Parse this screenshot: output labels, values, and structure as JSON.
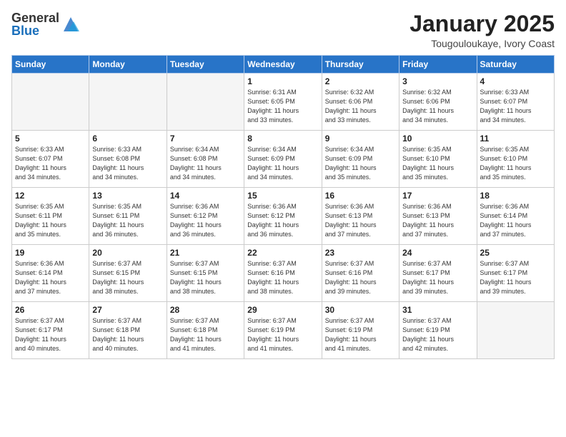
{
  "logo": {
    "general": "General",
    "blue": "Blue"
  },
  "header": {
    "title": "January 2025",
    "subtitle": "Tougouloukaye, Ivory Coast"
  },
  "weekdays": [
    "Sunday",
    "Monday",
    "Tuesday",
    "Wednesday",
    "Thursday",
    "Friday",
    "Saturday"
  ],
  "weeks": [
    [
      {
        "day": "",
        "info": ""
      },
      {
        "day": "",
        "info": ""
      },
      {
        "day": "",
        "info": ""
      },
      {
        "day": "1",
        "info": "Sunrise: 6:31 AM\nSunset: 6:05 PM\nDaylight: 11 hours\nand 33 minutes."
      },
      {
        "day": "2",
        "info": "Sunrise: 6:32 AM\nSunset: 6:06 PM\nDaylight: 11 hours\nand 33 minutes."
      },
      {
        "day": "3",
        "info": "Sunrise: 6:32 AM\nSunset: 6:06 PM\nDaylight: 11 hours\nand 34 minutes."
      },
      {
        "day": "4",
        "info": "Sunrise: 6:33 AM\nSunset: 6:07 PM\nDaylight: 11 hours\nand 34 minutes."
      }
    ],
    [
      {
        "day": "5",
        "info": "Sunrise: 6:33 AM\nSunset: 6:07 PM\nDaylight: 11 hours\nand 34 minutes."
      },
      {
        "day": "6",
        "info": "Sunrise: 6:33 AM\nSunset: 6:08 PM\nDaylight: 11 hours\nand 34 minutes."
      },
      {
        "day": "7",
        "info": "Sunrise: 6:34 AM\nSunset: 6:08 PM\nDaylight: 11 hours\nand 34 minutes."
      },
      {
        "day": "8",
        "info": "Sunrise: 6:34 AM\nSunset: 6:09 PM\nDaylight: 11 hours\nand 34 minutes."
      },
      {
        "day": "9",
        "info": "Sunrise: 6:34 AM\nSunset: 6:09 PM\nDaylight: 11 hours\nand 35 minutes."
      },
      {
        "day": "10",
        "info": "Sunrise: 6:35 AM\nSunset: 6:10 PM\nDaylight: 11 hours\nand 35 minutes."
      },
      {
        "day": "11",
        "info": "Sunrise: 6:35 AM\nSunset: 6:10 PM\nDaylight: 11 hours\nand 35 minutes."
      }
    ],
    [
      {
        "day": "12",
        "info": "Sunrise: 6:35 AM\nSunset: 6:11 PM\nDaylight: 11 hours\nand 35 minutes."
      },
      {
        "day": "13",
        "info": "Sunrise: 6:35 AM\nSunset: 6:11 PM\nDaylight: 11 hours\nand 36 minutes."
      },
      {
        "day": "14",
        "info": "Sunrise: 6:36 AM\nSunset: 6:12 PM\nDaylight: 11 hours\nand 36 minutes."
      },
      {
        "day": "15",
        "info": "Sunrise: 6:36 AM\nSunset: 6:12 PM\nDaylight: 11 hours\nand 36 minutes."
      },
      {
        "day": "16",
        "info": "Sunrise: 6:36 AM\nSunset: 6:13 PM\nDaylight: 11 hours\nand 37 minutes."
      },
      {
        "day": "17",
        "info": "Sunrise: 6:36 AM\nSunset: 6:13 PM\nDaylight: 11 hours\nand 37 minutes."
      },
      {
        "day": "18",
        "info": "Sunrise: 6:36 AM\nSunset: 6:14 PM\nDaylight: 11 hours\nand 37 minutes."
      }
    ],
    [
      {
        "day": "19",
        "info": "Sunrise: 6:36 AM\nSunset: 6:14 PM\nDaylight: 11 hours\nand 37 minutes."
      },
      {
        "day": "20",
        "info": "Sunrise: 6:37 AM\nSunset: 6:15 PM\nDaylight: 11 hours\nand 38 minutes."
      },
      {
        "day": "21",
        "info": "Sunrise: 6:37 AM\nSunset: 6:15 PM\nDaylight: 11 hours\nand 38 minutes."
      },
      {
        "day": "22",
        "info": "Sunrise: 6:37 AM\nSunset: 6:16 PM\nDaylight: 11 hours\nand 38 minutes."
      },
      {
        "day": "23",
        "info": "Sunrise: 6:37 AM\nSunset: 6:16 PM\nDaylight: 11 hours\nand 39 minutes."
      },
      {
        "day": "24",
        "info": "Sunrise: 6:37 AM\nSunset: 6:17 PM\nDaylight: 11 hours\nand 39 minutes."
      },
      {
        "day": "25",
        "info": "Sunrise: 6:37 AM\nSunset: 6:17 PM\nDaylight: 11 hours\nand 39 minutes."
      }
    ],
    [
      {
        "day": "26",
        "info": "Sunrise: 6:37 AM\nSunset: 6:17 PM\nDaylight: 11 hours\nand 40 minutes."
      },
      {
        "day": "27",
        "info": "Sunrise: 6:37 AM\nSunset: 6:18 PM\nDaylight: 11 hours\nand 40 minutes."
      },
      {
        "day": "28",
        "info": "Sunrise: 6:37 AM\nSunset: 6:18 PM\nDaylight: 11 hours\nand 41 minutes."
      },
      {
        "day": "29",
        "info": "Sunrise: 6:37 AM\nSunset: 6:19 PM\nDaylight: 11 hours\nand 41 minutes."
      },
      {
        "day": "30",
        "info": "Sunrise: 6:37 AM\nSunset: 6:19 PM\nDaylight: 11 hours\nand 41 minutes."
      },
      {
        "day": "31",
        "info": "Sunrise: 6:37 AM\nSunset: 6:19 PM\nDaylight: 11 hours\nand 42 minutes."
      },
      {
        "day": "",
        "info": ""
      }
    ]
  ]
}
